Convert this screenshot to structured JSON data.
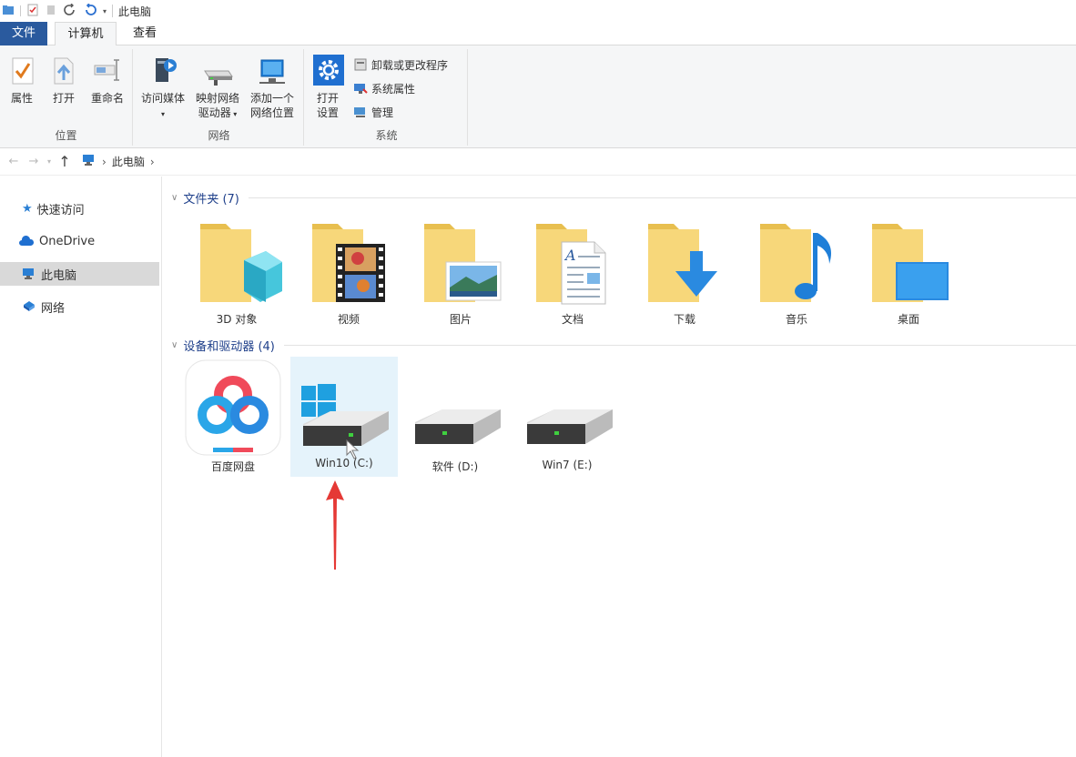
{
  "window": {
    "title": "此电脑"
  },
  "tabs": [
    {
      "label": "文件"
    },
    {
      "label": "计算机"
    },
    {
      "label": "查看"
    }
  ],
  "ribbon": {
    "location": {
      "label": "位置",
      "properties": "属性",
      "open": "打开",
      "rename": "重命名"
    },
    "network": {
      "label": "网络",
      "access_media": "访问媒体",
      "map_drive_line1": "映射网络",
      "map_drive_line2": "驱动器",
      "add_location_line1": "添加一个",
      "add_location_line2": "网络位置"
    },
    "system": {
      "label": "系统",
      "open_settings_line1": "打开",
      "open_settings_line2": "设置",
      "uninstall": "卸载或更改程序",
      "system_properties": "系统属性",
      "manage": "管理"
    }
  },
  "address": {
    "crumbs": [
      "此电脑"
    ]
  },
  "sidebar": {
    "items": [
      {
        "label": "快速访问"
      },
      {
        "label": "OneDrive"
      },
      {
        "label": "此电脑"
      },
      {
        "label": "网络"
      }
    ]
  },
  "folders_section": {
    "header": "文件夹 (7)",
    "items": [
      {
        "label": "3D 对象"
      },
      {
        "label": "视频"
      },
      {
        "label": "图片"
      },
      {
        "label": "文档"
      },
      {
        "label": "下载"
      },
      {
        "label": "音乐"
      },
      {
        "label": "桌面"
      }
    ]
  },
  "devices_section": {
    "header": "设备和驱动器 (4)",
    "items": [
      {
        "label": "百度网盘"
      },
      {
        "label": "Win10 (C:)"
      },
      {
        "label": "软件 (D:)"
      },
      {
        "label": "Win7 (E:)"
      }
    ]
  },
  "colors": {
    "accent": "#2a5a9e",
    "folder": "#f7d77a",
    "folder_back": "#e8bf4f",
    "selection": "#e5f3fb",
    "arrow": "#e53935"
  }
}
